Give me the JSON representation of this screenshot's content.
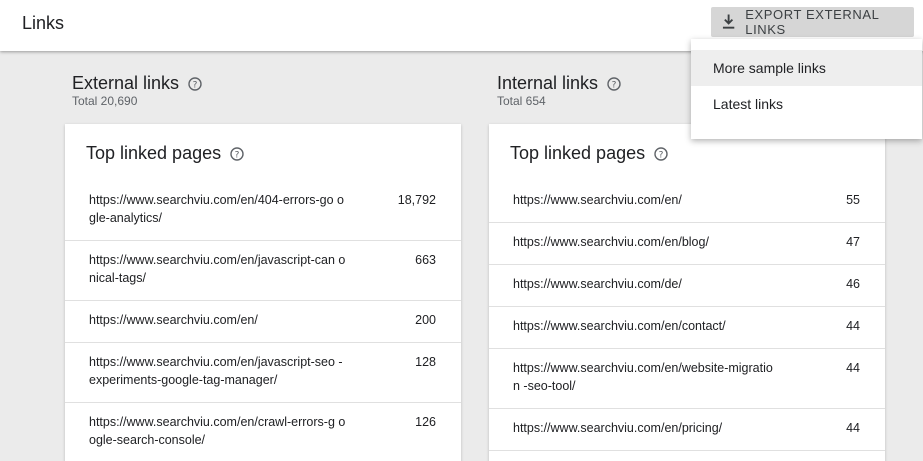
{
  "header": {
    "title": "Links",
    "export_label": "EXPORT EXTERNAL LINKS"
  },
  "menu": {
    "items": [
      "More sample links",
      "Latest links"
    ]
  },
  "external": {
    "title": "External links",
    "total": "Total 20,690",
    "card_title": "Top linked pages",
    "rows": [
      {
        "url": "https://www.searchviu.com/en/404-errors-go ogle-analytics/",
        "count": "18,792"
      },
      {
        "url": "https://www.searchviu.com/en/javascript-can onical-tags/",
        "count": "663"
      },
      {
        "url": "https://www.searchviu.com/en/",
        "count": "200"
      },
      {
        "url": "https://www.searchviu.com/en/javascript-seo -experiments-google-tag-manager/",
        "count": "128"
      },
      {
        "url": "https://www.searchviu.com/en/crawl-errors-g oogle-search-console/",
        "count": "126"
      }
    ]
  },
  "internal": {
    "title": "Internal links",
    "total": "Total 654",
    "card_title": "Top linked pages",
    "rows": [
      {
        "url": "https://www.searchviu.com/en/",
        "count": "55"
      },
      {
        "url": "https://www.searchviu.com/en/blog/",
        "count": "47"
      },
      {
        "url": "https://www.searchviu.com/de/",
        "count": "46"
      },
      {
        "url": "https://www.searchviu.com/en/contact/",
        "count": "44"
      },
      {
        "url": "https://www.searchviu.com/en/website-migration -seo-tool/",
        "count": "44"
      },
      {
        "url": "https://www.searchviu.com/en/pricing/",
        "count": "44"
      }
    ]
  },
  "icons": {
    "export": "download-icon",
    "help": "help-circle-icon"
  }
}
